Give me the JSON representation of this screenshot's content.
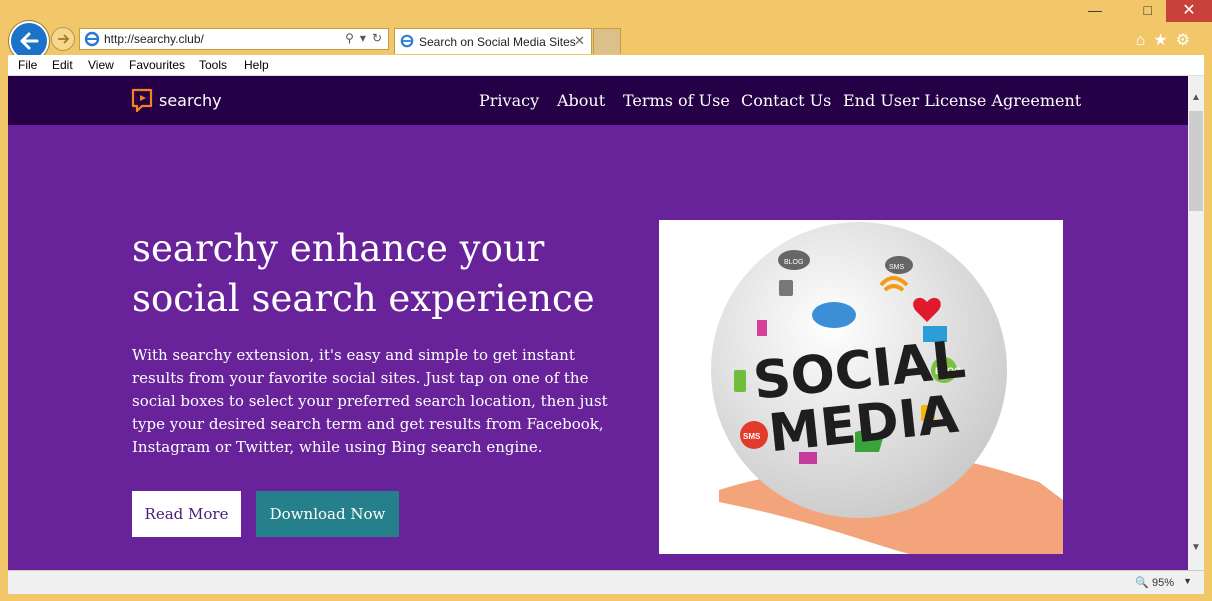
{
  "browser": {
    "url": "http://searchy.club/",
    "tab_title": "Search on Social Media Sites",
    "menu": [
      "File",
      "Edit",
      "View",
      "Favourites",
      "Tools",
      "Help"
    ],
    "zoom": "95%"
  },
  "site": {
    "logo_text": "searchy",
    "nav": [
      "Privacy",
      "About",
      "Terms of Use",
      "Contact Us",
      "End User License Agreement"
    ],
    "hero": {
      "title_line1": "searchy enhance your",
      "title_line2": "social search experience",
      "body": "With searchy extension, it's easy and simple to get instant results from your favorite social sites. Just tap on one of the social boxes to select your preferred search location, then just type your desired search term and get results from Facebook, Instagram or Twitter, while using Bing search engine.",
      "read_more": "Read More",
      "download_now": "Download Now"
    },
    "image": {
      "line1": "SOCIAL",
      "line2": "MEDIA",
      "badges": [
        "BLOG",
        "SMS",
        "SMS",
        "BLOG"
      ]
    }
  }
}
